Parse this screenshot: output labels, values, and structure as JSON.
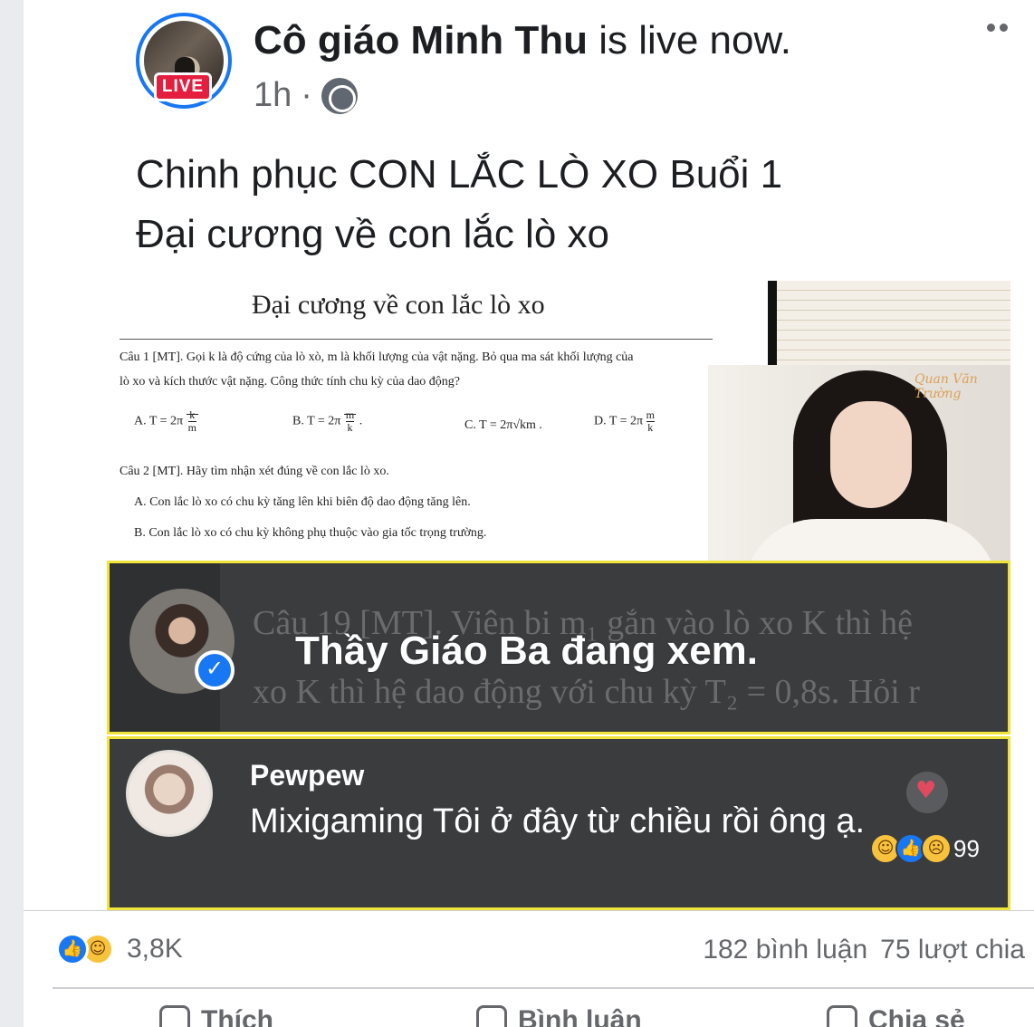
{
  "post": {
    "author": "Cô giáo Minh Thu",
    "status": " is live now.",
    "live_badge": "LIVE",
    "time": "1h",
    "separator": "·",
    "text_line1": "Chinh phục CON LẮC LÒ XO Buổi 1",
    "text_line2": "Đại cương về con lắc lò xo"
  },
  "video": {
    "doc_title": "Đại cương về con lắc lò xo",
    "q1_line1": "Câu 1 [MT]. Gọi k là độ cứng của lò xò, m là khối lượng của vật nặng. Bỏ qua ma sát khối lượng của",
    "q1_line2": "lò xo và kích thước vật nặng. Công thức tính chu kỳ của dao động?",
    "opt_a": "A. T = 2π",
    "opt_b": "B. T = 2π",
    "opt_c": "C. T = 2π√km .",
    "opt_d": "D. T = 2π",
    "q2": "Câu 2 [MT]. Hãy tìm nhận xét đúng về con lắc lò xo.",
    "q2_a": "A. Con lắc lò xo có chu kỳ tăng lên khi biên độ dao động tăng lên.",
    "q2_b": "B. Con lắc lò xo có chu kỳ không phụ thuộc vào gia tốc trọng trường.",
    "watermark": "Quan Văn Trường",
    "bg_line1": "Câu 19 [MT]. Viên bi m₁ gắn vào lò xo K thì hệ",
    "bg_line2": "xo K thì hệ dao động với chu kỳ T₂ = 0,8s. Hỏi r",
    "watching_text": "Thầy Giáo Ba đang xem.",
    "comment_name": "Pewpew",
    "comment_text": "Mixigaming Tôi ở đây từ chiều rồi ông ạ.",
    "comment_reaction_count": "99"
  },
  "footer": {
    "reaction_count": "3,8K",
    "comments": "182 bình luận",
    "shares": "75 lượt chia",
    "like_label": "Thích",
    "comment_label": "Bình luận",
    "share_label": "Chia sẻ"
  },
  "colors": {
    "facebook_blue": "#1877f2",
    "live_red": "#e41e3f",
    "highlight_border": "#f0e33a"
  }
}
